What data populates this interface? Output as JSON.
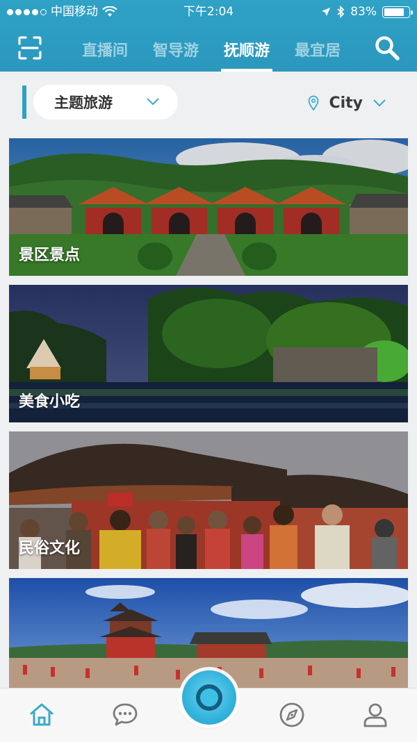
{
  "status_bar": {
    "carrier": "中国移动",
    "time": "下午2:04",
    "battery": "83%",
    "battery_level": 0.83
  },
  "nav": {
    "tabs": [
      {
        "label": "直播间",
        "active": false
      },
      {
        "label": "智导游",
        "active": false
      },
      {
        "label": "抚顺游",
        "active": true
      },
      {
        "label": "最宜居",
        "active": false
      }
    ],
    "scan_icon": "scan-icon",
    "search_icon": "search-icon"
  },
  "filters": {
    "theme": {
      "selected": "主题旅游"
    },
    "city": {
      "selected": "City"
    }
  },
  "cards": [
    {
      "label": "景区景点"
    },
    {
      "label": "美食小吃"
    },
    {
      "label": "民俗文化"
    },
    {
      "label": ""
    }
  ],
  "tabbar": {
    "items": [
      "home-icon",
      "chat-icon",
      "center-action",
      "compass-icon",
      "user-icon"
    ]
  },
  "colors": {
    "header": "#2fa2c6",
    "accent": "#2fa2c6",
    "tab_icon": "#3aa9cc",
    "background": "#eef0f2"
  }
}
